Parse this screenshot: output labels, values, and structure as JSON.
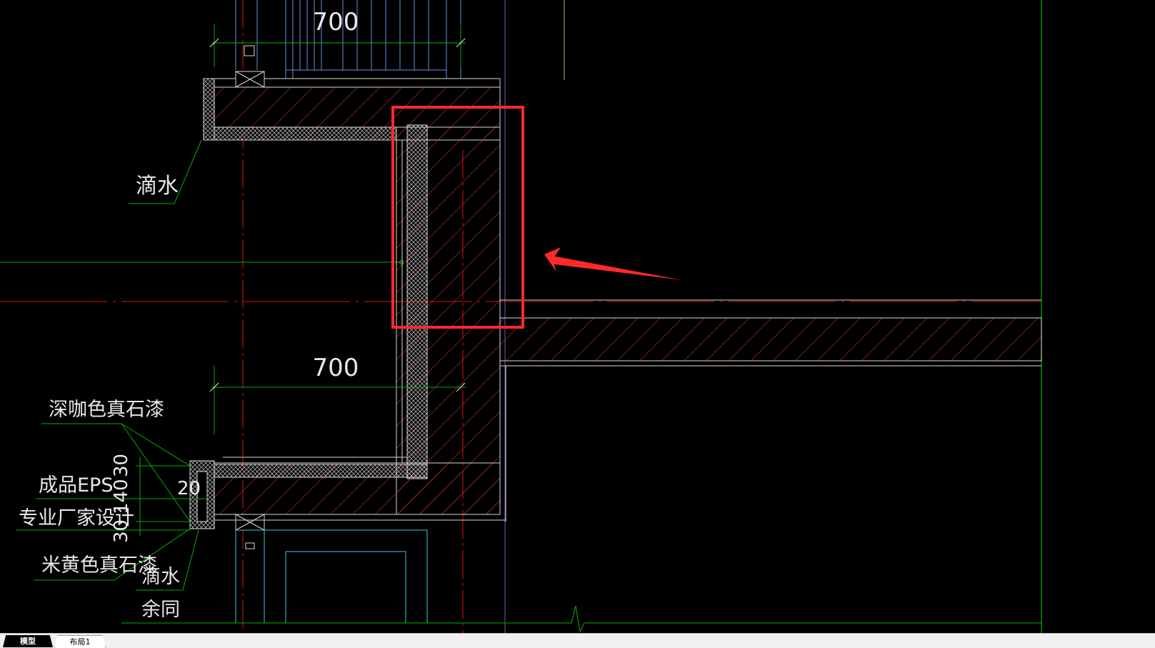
{
  "drawing": {
    "dimension_top": "700",
    "dimension_mid": "700",
    "label_drip_top": "滴水",
    "label_dark_paint": "深咖色真石漆",
    "label_eps": "成品EPS",
    "label_manufacturer": "专业厂家设计",
    "label_yellow_paint": "米黄色真石漆",
    "label_drip_bottom": "滴水",
    "label_rest_same": "余同",
    "dim_30_top": "30",
    "dim_140": "140",
    "dim_30_bottom": "30",
    "dim_20": "20"
  },
  "annotation": {
    "highlight_color": "#ff2a2a",
    "arrow_color": "#ff2a2a"
  },
  "tabs": {
    "model": "模型",
    "layout1": "布局1"
  },
  "colors": {
    "background": "#000000",
    "green": "#00c000",
    "red_axis": "#e01010",
    "white_line": "#d8d8d8",
    "cyan": "#40c8d8"
  }
}
